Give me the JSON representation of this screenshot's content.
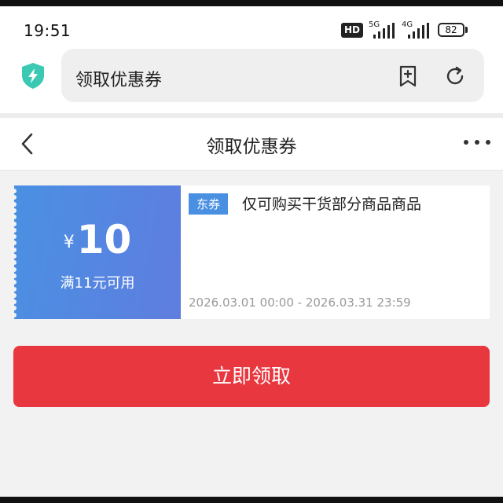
{
  "status_bar": {
    "time": "19:51",
    "hd_badge": "HD",
    "network_1": "5G",
    "network_2": "4G",
    "battery": "82"
  },
  "browser": {
    "url_title": "领取优惠券",
    "security_icon": "shield-bolt-icon",
    "bookmark_icon": "bookmark-add-icon",
    "reload_icon": "reload-icon"
  },
  "header": {
    "title": "领取优惠券",
    "back_icon": "chevron-left-icon",
    "more_icon": "more-dots-icon"
  },
  "coupon": {
    "currency": "¥",
    "amount": "10",
    "condition": "满11元可用",
    "tag": "东券",
    "description": "仅可购买干货部分商品商品",
    "validity": "2026.03.01 00:00 - 2026.03.31 23:59"
  },
  "actions": {
    "claim_label": "立即领取"
  },
  "colors": {
    "coupon_blue": "#4a90e2",
    "claim_red": "#e8373f",
    "shield_teal": "#3cc9b4"
  }
}
